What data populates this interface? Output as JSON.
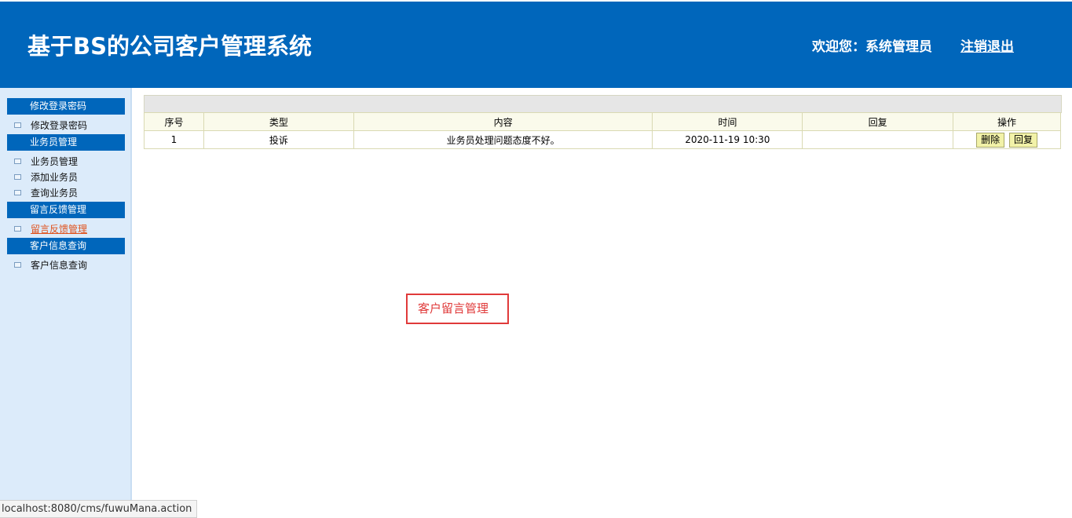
{
  "header": {
    "title": "基于BS的公司客户管理系统",
    "welcome": "欢迎您：系统管理员",
    "logout": "注销退出"
  },
  "sidebar": {
    "groups": [
      {
        "title": "修改登录密码",
        "items": [
          "修改登录密码"
        ]
      },
      {
        "title": "业务员管理",
        "items": [
          "业务员管理",
          "添加业务员",
          "查询业务员"
        ]
      },
      {
        "title": "留言反馈管理",
        "items": [
          "留言反馈管理"
        ]
      },
      {
        "title": "客户信息查询",
        "items": [
          "客户信息查询"
        ]
      }
    ],
    "active_item": "留言反馈管理"
  },
  "table": {
    "headers": [
      "序号",
      "类型",
      "内容",
      "时间",
      "回复",
      "操作"
    ],
    "rows": [
      {
        "id": "1",
        "type": "投诉",
        "content": "业务员处理问题态度不好。",
        "time": "2020-11-19 10:30",
        "reply": "",
        "delete_label": "删除",
        "reply_label": "回复"
      }
    ]
  },
  "annotation": "客户留言管理",
  "status_url": "localhost:8080/cms/fuwuMana.action",
  "colors": {
    "header_bg": "#0066bb",
    "sidebar_bg": "#dcebfa",
    "active_link": "#e0521c",
    "annotation": "#e03a3a"
  }
}
